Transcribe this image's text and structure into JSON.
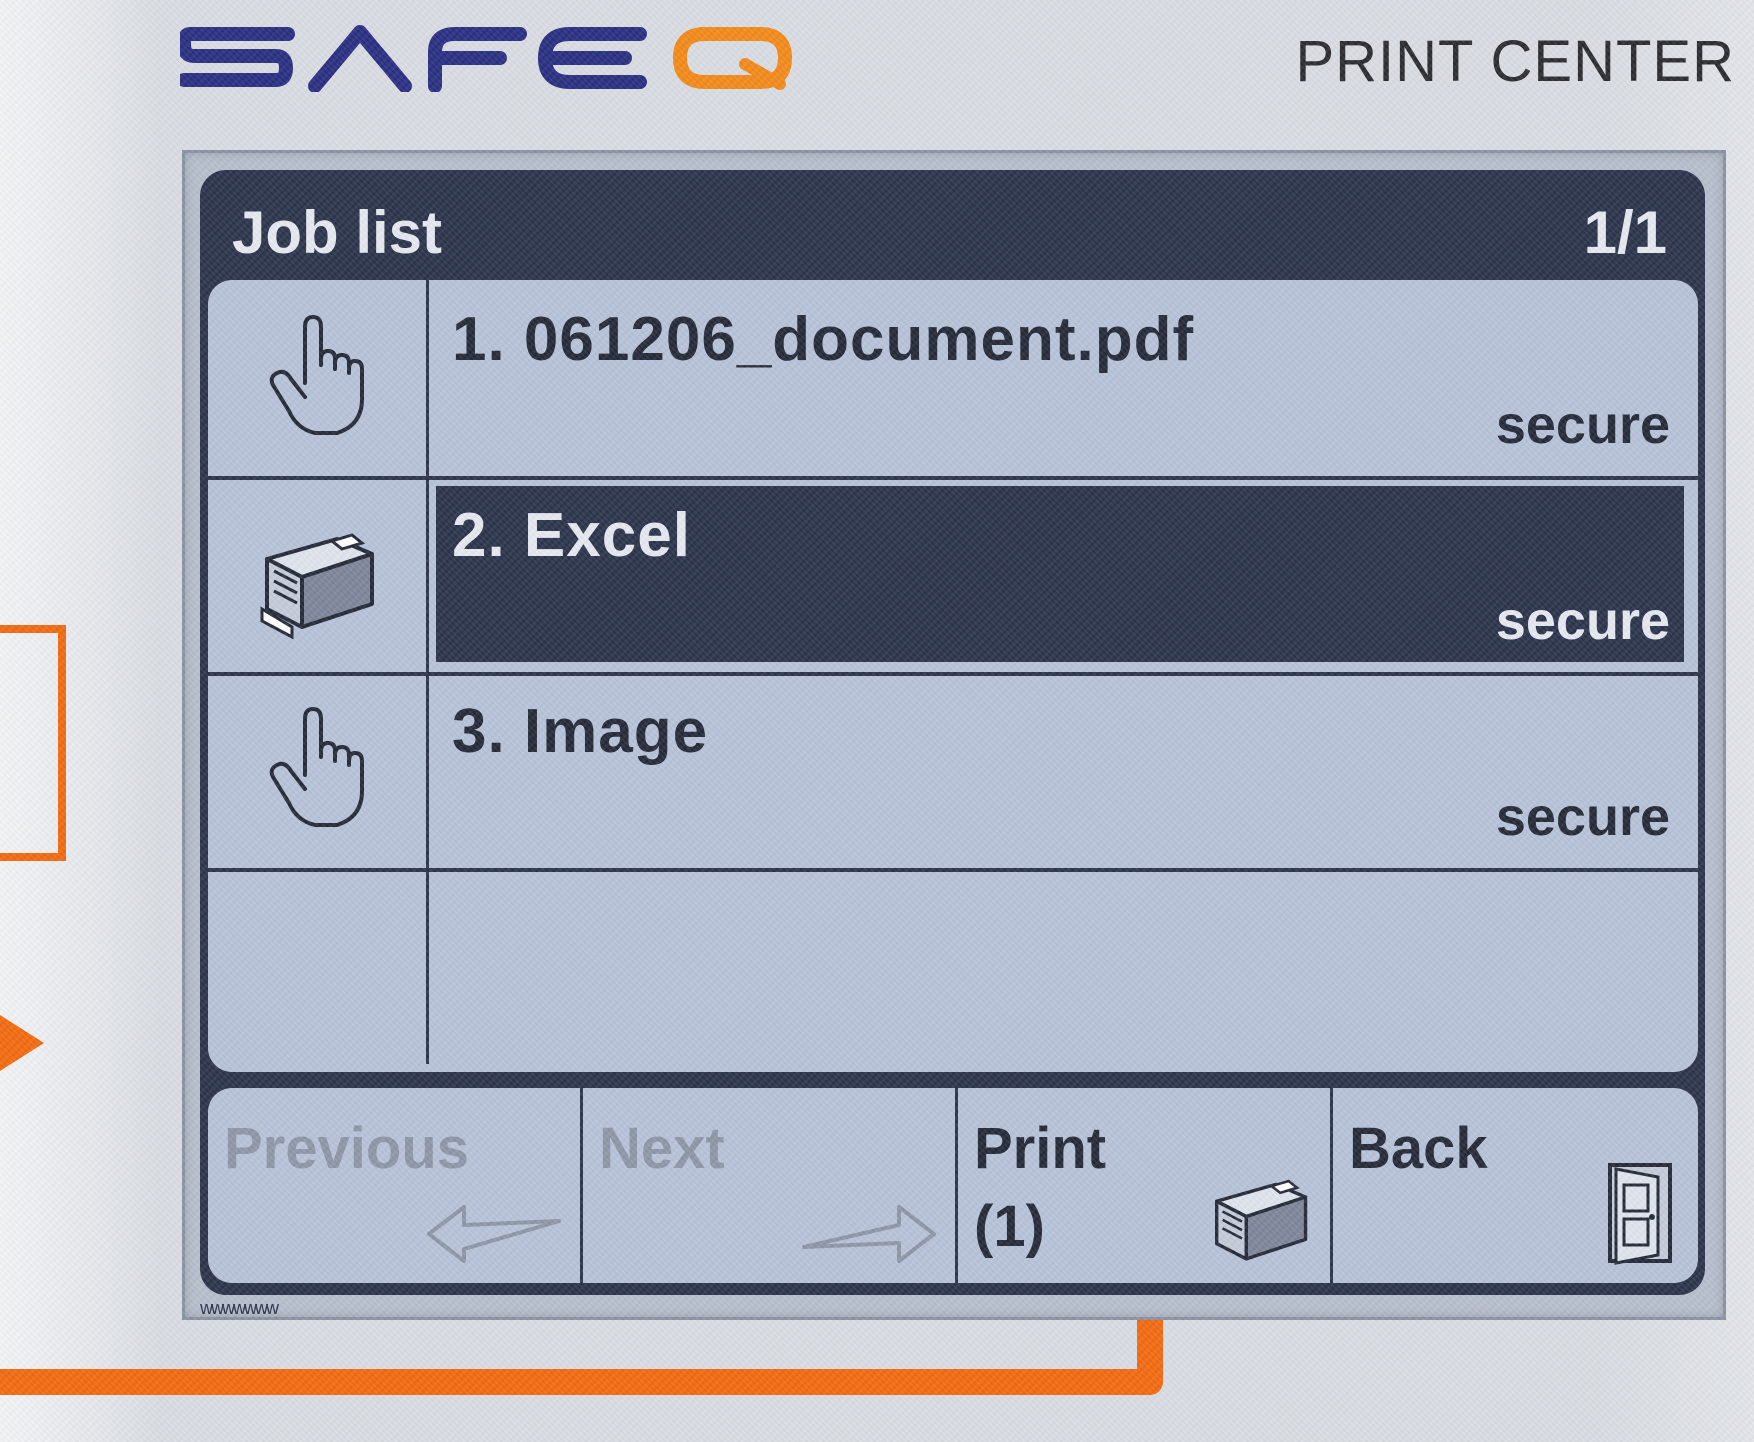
{
  "brand": {
    "logo_text": "SAFEQ",
    "colors": {
      "logo_blue": "#2a2f82",
      "logo_orange": "#f28a1a"
    }
  },
  "header": {
    "title": "PRINT CENTER"
  },
  "screen": {
    "title": "Job list",
    "page_indicator": "1/1",
    "jobs": [
      {
        "name": "1. 061206_document.pdf",
        "status": "secure",
        "icon": "hand-pointer-icon",
        "selected": false
      },
      {
        "name": "2. Excel",
        "status": "secure",
        "icon": "printer-icon",
        "selected": true
      },
      {
        "name": "3. Image",
        "status": "secure",
        "icon": "hand-pointer-icon",
        "selected": false
      }
    ],
    "buttons": {
      "previous": {
        "label": "Previous",
        "icon": "arrow-left-icon",
        "enabled": false
      },
      "next": {
        "label": "Next",
        "icon": "arrow-right-icon",
        "enabled": false
      },
      "print": {
        "label": "Print\n(1)",
        "icon": "printer-icon",
        "enabled": true
      },
      "back": {
        "label": "Back",
        "icon": "exit-door-icon",
        "enabled": true
      }
    },
    "corner_mark": "wwwwwww"
  },
  "annotation": {
    "color": "#f26a10"
  }
}
